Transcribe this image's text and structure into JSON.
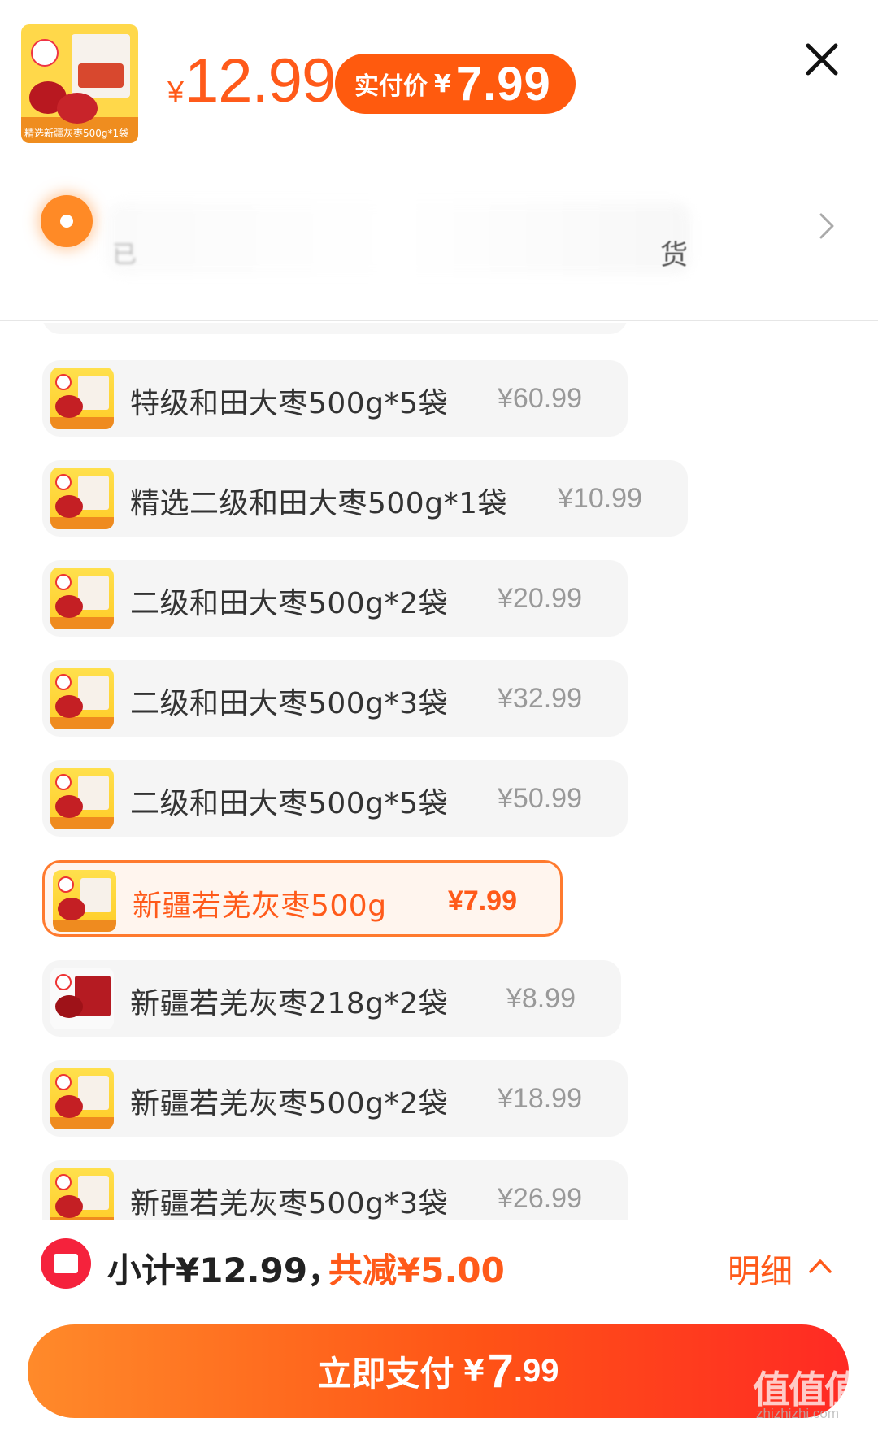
{
  "header": {
    "product_thumb_caption": "精选新疆灰枣500g*1袋",
    "price_currency": "¥",
    "price": "12.99",
    "actual_pay_label": "实付价",
    "actual_pay_currency": "¥",
    "actual_pay_value": "7.99"
  },
  "promo": {
    "text_left": "已",
    "text_right": "货"
  },
  "options": [
    {
      "name": "特级和田大枣500g*5袋",
      "price": "¥60.99",
      "selected": false,
      "thumb": "yellow"
    },
    {
      "name": "精选二级和田大枣500g*1袋",
      "price": "¥10.99",
      "selected": false,
      "thumb": "yellow"
    },
    {
      "name": "二级和田大枣500g*2袋",
      "price": "¥20.99",
      "selected": false,
      "thumb": "yellow"
    },
    {
      "name": "二级和田大枣500g*3袋",
      "price": "¥32.99",
      "selected": false,
      "thumb": "yellow"
    },
    {
      "name": "二级和田大枣500g*5袋",
      "price": "¥50.99",
      "selected": false,
      "thumb": "yellow"
    },
    {
      "name": "新疆若羌灰枣500g",
      "price": "¥7.99",
      "selected": true,
      "thumb": "yellow"
    },
    {
      "name": "新疆若羌灰枣218g*2袋",
      "price": "¥8.99",
      "selected": false,
      "thumb": "dark"
    },
    {
      "name": "新疆若羌灰枣500g*2袋",
      "price": "¥18.99",
      "selected": false,
      "thumb": "yellow"
    },
    {
      "name": "新疆若羌灰枣500g*3袋",
      "price": "¥26.99",
      "selected": false,
      "thumb": "yellow"
    }
  ],
  "footer": {
    "subtotal": "小计¥12.99，",
    "saving": "共减¥5.00",
    "detail_label": "明细",
    "pay_label": "立即支付",
    "pay_currency": "¥",
    "pay_integer": "7",
    "pay_decimal": ".99",
    "watermark": "值值值",
    "watermark_url": "zhizhizhi.com"
  },
  "colors": {
    "accent": "#ff5a1a",
    "pill": "#ff5a0e",
    "coupon": "#f5223c"
  }
}
